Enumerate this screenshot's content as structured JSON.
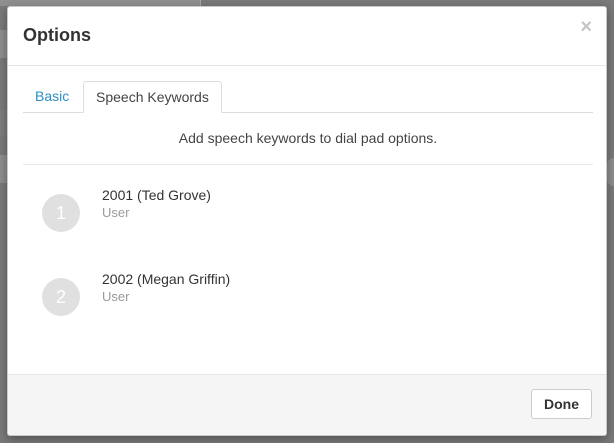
{
  "modal": {
    "title": "Options",
    "close_symbol": "×",
    "tabs": [
      {
        "label": "Basic",
        "active": false
      },
      {
        "label": "Speech Keywords",
        "active": true
      }
    ],
    "hint": "Add speech keywords to dial pad options.",
    "entries": [
      {
        "index": "1",
        "name": "2001 (Ted Grove)",
        "type": "User"
      },
      {
        "index": "2",
        "name": "2002 (Megan Griffin)",
        "type": "User"
      }
    ],
    "done_label": "Done"
  },
  "colors": {
    "overlay": "#7a7a7a",
    "link_tab": "#2a8fc4",
    "badge": "#e0e0e0",
    "footer": "#f5f5f5"
  }
}
